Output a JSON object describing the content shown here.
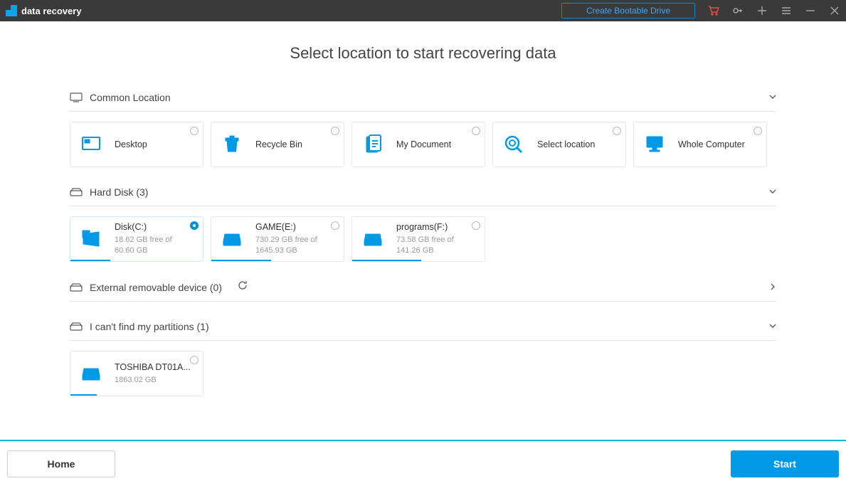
{
  "titlebar": {
    "app_name": "data recovery",
    "bootable_button": "Create Bootable Drive"
  },
  "page_title": "Select location to start recovering data",
  "sections": {
    "common": {
      "title": "Common Location"
    },
    "harddisk": {
      "title": "Hard Disk (3)"
    },
    "external": {
      "title": "External removable device (0)"
    },
    "cantfind": {
      "title": "I can't find my partitions (1)"
    }
  },
  "cards": {
    "desktop": {
      "label": "Desktop"
    },
    "recycle": {
      "label": "Recycle Bin"
    },
    "documents": {
      "label": "My Document"
    },
    "select": {
      "label": "Select location"
    },
    "whole": {
      "label": "Whole Computer"
    },
    "diskC": {
      "label": "Disk(C:)",
      "sub": "18.62 GB  free of 60.60 GB"
    },
    "diskE": {
      "label": "GAME(E:)",
      "sub": "730.29 GB  free of 1645.93 GB"
    },
    "diskF": {
      "label": "programs(F:)",
      "sub": "73.58 GB  free of 141.26 GB"
    },
    "toshiba": {
      "label": "TOSHIBA DT01A...",
      "sub": "1863.02 GB"
    }
  },
  "footer": {
    "home": "Home",
    "start": "Start"
  }
}
